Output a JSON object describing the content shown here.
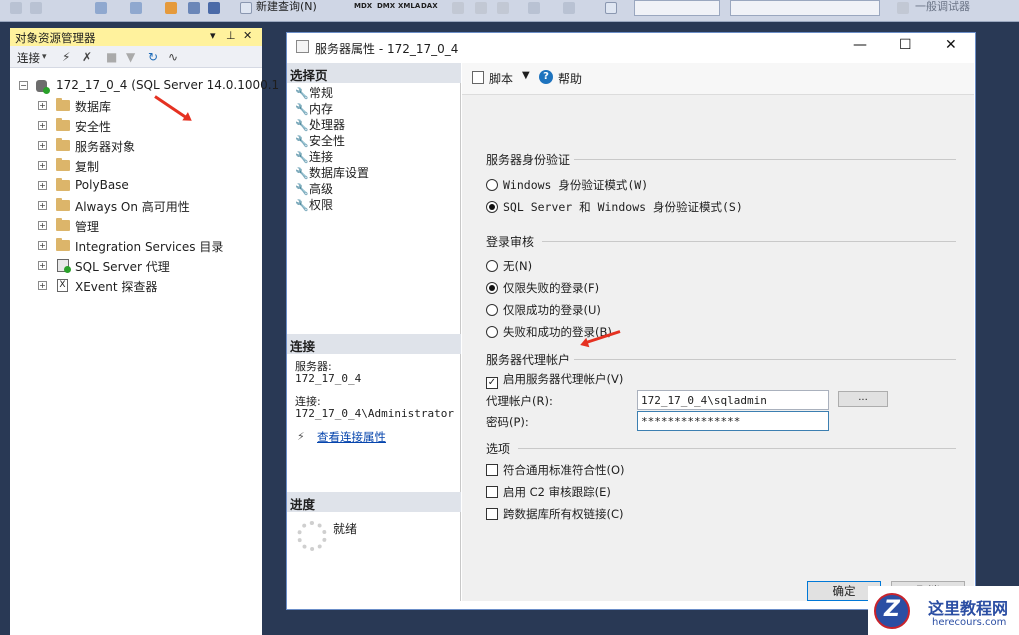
{
  "toolbar": {
    "new_query_label": "新建查询(N)",
    "script_types": [
      "MDX",
      "DMX",
      "XMLA",
      "DAX"
    ],
    "debugger_label": "一般调试器"
  },
  "object_explorer": {
    "title": "对象资源管理器",
    "connect_label": "连接",
    "server_node": "172_17_0_4 (SQL Server 14.0.1000.1",
    "items": [
      {
        "label": "数据库",
        "icon": "folder-icon"
      },
      {
        "label": "安全性",
        "icon": "folder-icon"
      },
      {
        "label": "服务器对象",
        "icon": "folder-icon"
      },
      {
        "label": "复制",
        "icon": "folder-icon"
      },
      {
        "label": "PolyBase",
        "icon": "folder-icon"
      },
      {
        "label": "Always On 高可用性",
        "icon": "folder-icon"
      },
      {
        "label": "管理",
        "icon": "folder-icon"
      },
      {
        "label": "Integration Services 目录",
        "icon": "folder-icon"
      },
      {
        "label": "SQL Server 代理",
        "icon": "agent-icon"
      },
      {
        "label": "XEvent 探查器",
        "icon": "xevent-icon"
      }
    ]
  },
  "dialog": {
    "title": "服务器属性 - 172_17_0_4",
    "select_page_header": "选择页",
    "pages": [
      "常规",
      "内存",
      "处理器",
      "安全性",
      "连接",
      "数据库设置",
      "高级",
      "权限"
    ],
    "connection_header": "连接",
    "server_label": "服务器:",
    "server_value": "172_17_0_4",
    "conn_label": "连接:",
    "conn_value": "172_17_0_4\\Administrator",
    "view_conn_props": "查看连接属性",
    "progress_header": "进度",
    "progress_status": "就绪",
    "script_label": "脚本",
    "help_label": "帮助",
    "auth_group": "服务器身份验证",
    "auth_windows": "Windows 身份验证模式(W)",
    "auth_mixed": "SQL Server 和 Windows 身份验证模式(S)",
    "audit_group": "登录审核",
    "audit_none": "无(N)",
    "audit_failed": "仅限失败的登录(F)",
    "audit_success": "仅限成功的登录(U)",
    "audit_both": "失败和成功的登录(B)",
    "proxy_group": "服务器代理帐户",
    "enable_proxy": "启用服务器代理帐户(V)",
    "proxy_account_label": "代理帐户(R):",
    "proxy_account_value": "172_17_0_4\\sqladmin",
    "password_label": "密码(P):",
    "password_value": "***************",
    "browse_button": "...",
    "options_group": "选项",
    "opt_common_criteria": "符合通用标准符合性(O)",
    "opt_c2": "启用 C2 审核跟踪(E)",
    "opt_cross_db": "跨数据库所有权链接(C)",
    "ok_button": "确定",
    "cancel_button": "取消"
  },
  "watermark": {
    "seal_letter": "Z",
    "title": "这里教程网",
    "url": "herecours.com"
  },
  "colors": {
    "accent": "#2b4ea3",
    "arrow": "#e53121",
    "oe_title_bg": "#fff29d"
  }
}
